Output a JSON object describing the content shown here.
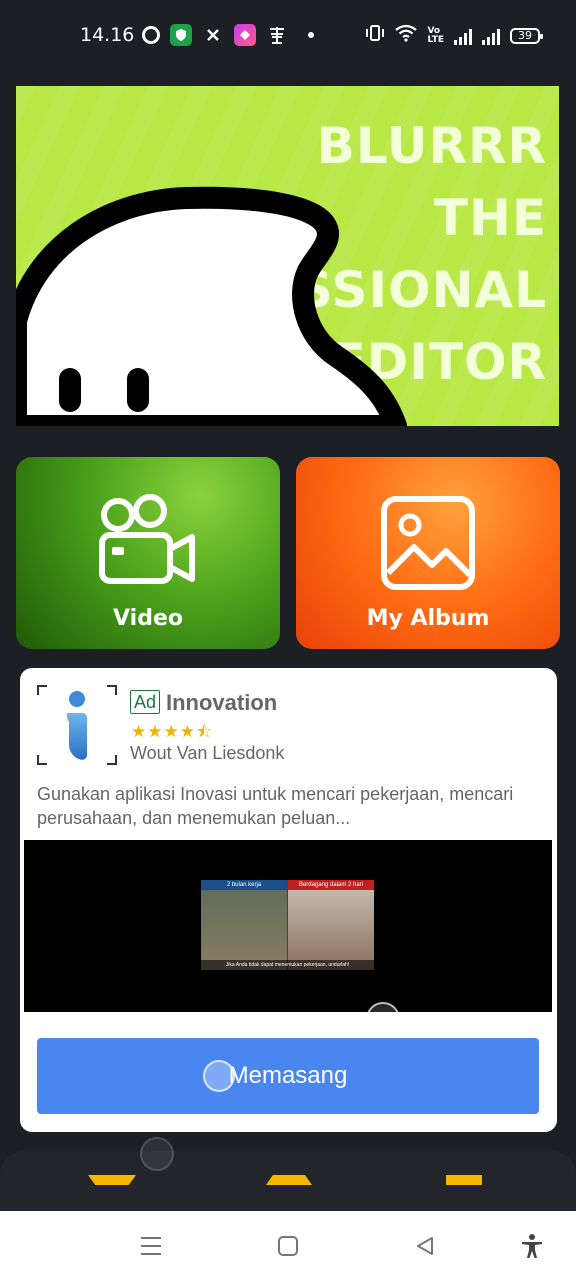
{
  "status_bar": {
    "time": "14.16",
    "volte_label": "Vo\nLTE",
    "battery": "39"
  },
  "banner": {
    "lines": [
      "BLURRR",
      "THE",
      "ESSIONAL",
      "V EDITOR"
    ],
    "colors": {
      "background": "#b7e844",
      "ghost": "#ffffff",
      "outline": "#000000"
    }
  },
  "tiles": {
    "video_label": "Video",
    "album_label": "My Album"
  },
  "ad": {
    "badge": "Ad",
    "title": "Innovation",
    "rating": 4.5,
    "stars_text": "★★★★⯪",
    "author": "Wout Van Liesdonk",
    "description": "Gunakan aplikasi Inovasi untuk mencari pekerjaan, mencari perusahaan, dan menemukan peluan...",
    "thumb_tag_left": "2 bulan kerja",
    "thumb_tag_right": "Berdagang dalam 2 hari",
    "thumb_caption": "Jika Anda tidak dapat menemukan pekerjaan, undurlah!",
    "install_label": "Memasang",
    "colors": {
      "install": "#4a86f0",
      "badge": "#1b7a3a",
      "stars": "#f2b300"
    }
  },
  "icons": {
    "sys_menu": "☰",
    "sys_home": "▢",
    "sys_back": "◁",
    "sys_accessibility": "accessibility-icon"
  }
}
